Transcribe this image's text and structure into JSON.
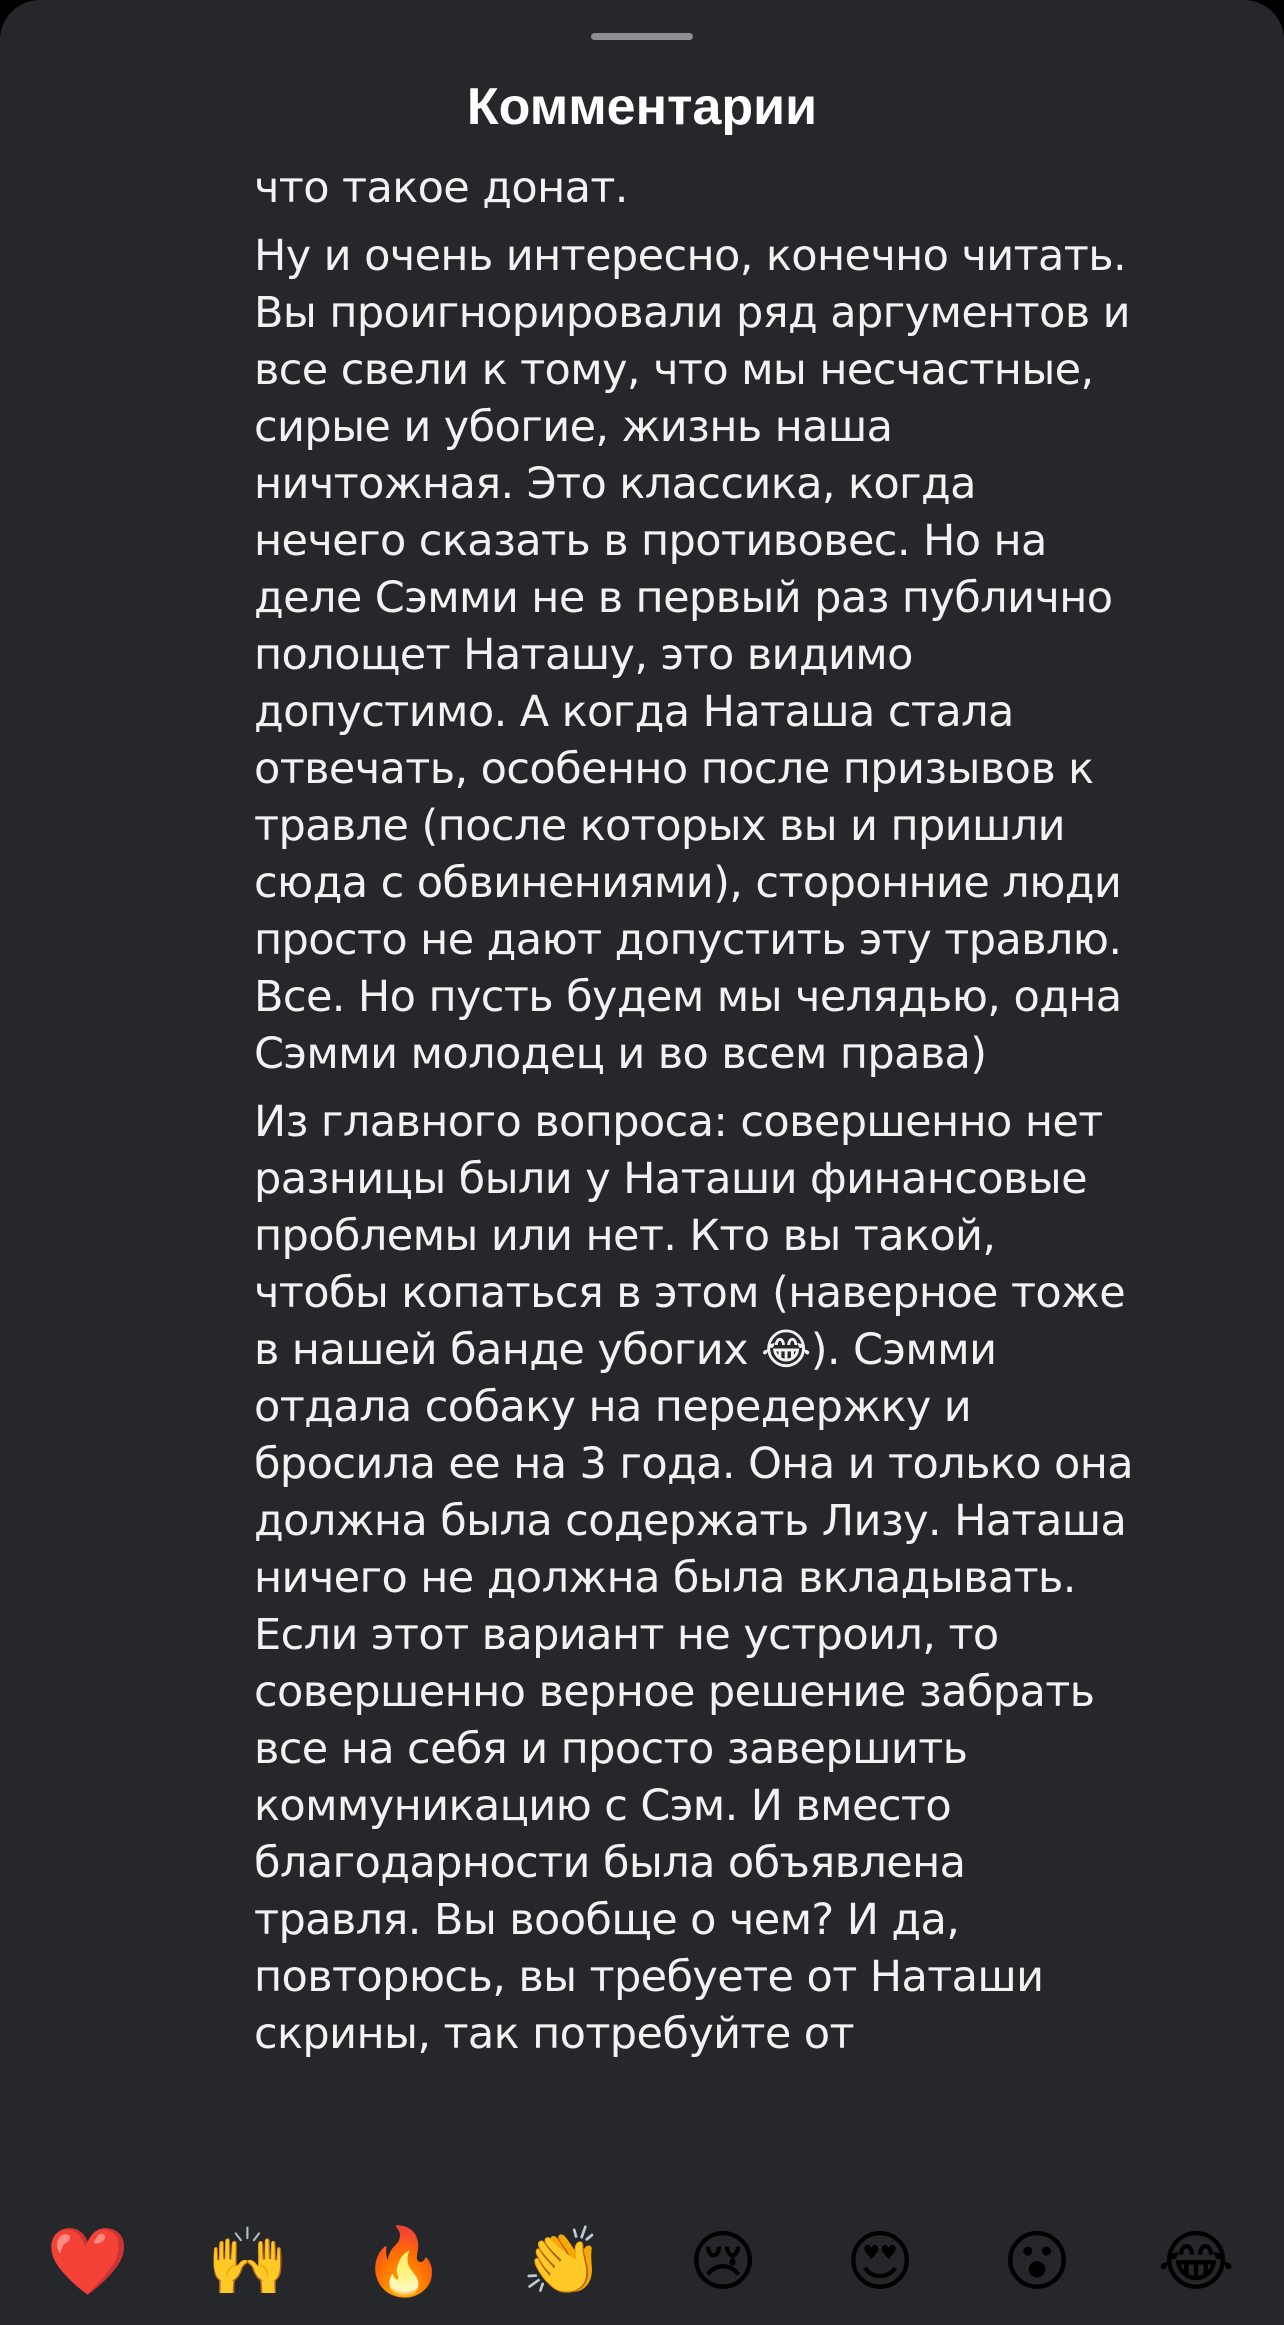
{
  "header": {
    "title": "Комментарии"
  },
  "comment": {
    "paragraphs": [
      "что такое донат.",
      "Ну и очень интересно, конечно читать. Вы проигнорировали ряд аргументов и все свели к тому, что мы несчастные, сирые и убогие, жизнь наша ничтожная. Это классика, когда нечего сказать в противовес. Но на деле Сэмми не в первый раз публично полощет Наташу, это видимо допустимо. А когда Наташа стала отвечать, особенно после призывов к травле (после которых вы и пришли сюда с обвинениями), сторонние люди просто не дают допустить эту травлю. Все. Но пусть будем мы челядью, одна Сэмми молодец и во всем права)",
      "Из главного вопроса: совершенно нет разницы были у Наташи финансовые проблемы или нет. Кто вы такой, чтобы копаться в этом (наверное тоже в нашей банде убогих 😂). Сэмми отдала собаку на передержку и бросила ее на 3 года. Она и только она должна была содержать Лизу. Наташа ничего не должна была вкладывать. Если этот вариант не устроил, то совершенно верное решение забрать все на себя и просто завершить коммуникацию с Сэм. И вместо  благодарности была объявлена травля. Вы вообще о чем? И да, повторюсь, вы требуете от Наташи скрины, так потребуйте от"
    ]
  },
  "reactions": [
    {
      "emoji": "❤️",
      "icon": "red-heart-icon"
    },
    {
      "emoji": "🙌",
      "icon": "raising-hands-icon"
    },
    {
      "emoji": "🔥",
      "icon": "fire-icon"
    },
    {
      "emoji": "👏",
      "icon": "clapping-hands-icon"
    },
    {
      "emoji": "😢",
      "icon": "crying-face-icon"
    },
    {
      "emoji": "😍",
      "icon": "heart-eyes-face-icon"
    },
    {
      "emoji": "😮",
      "icon": "surprised-face-icon"
    },
    {
      "emoji": "😂",
      "icon": "tears-of-joy-face-icon"
    }
  ],
  "colors": {
    "sheet_background": "#25272b",
    "text": "#f2f2f2",
    "title": "#ffffff",
    "grabber": "#8e8e93"
  }
}
